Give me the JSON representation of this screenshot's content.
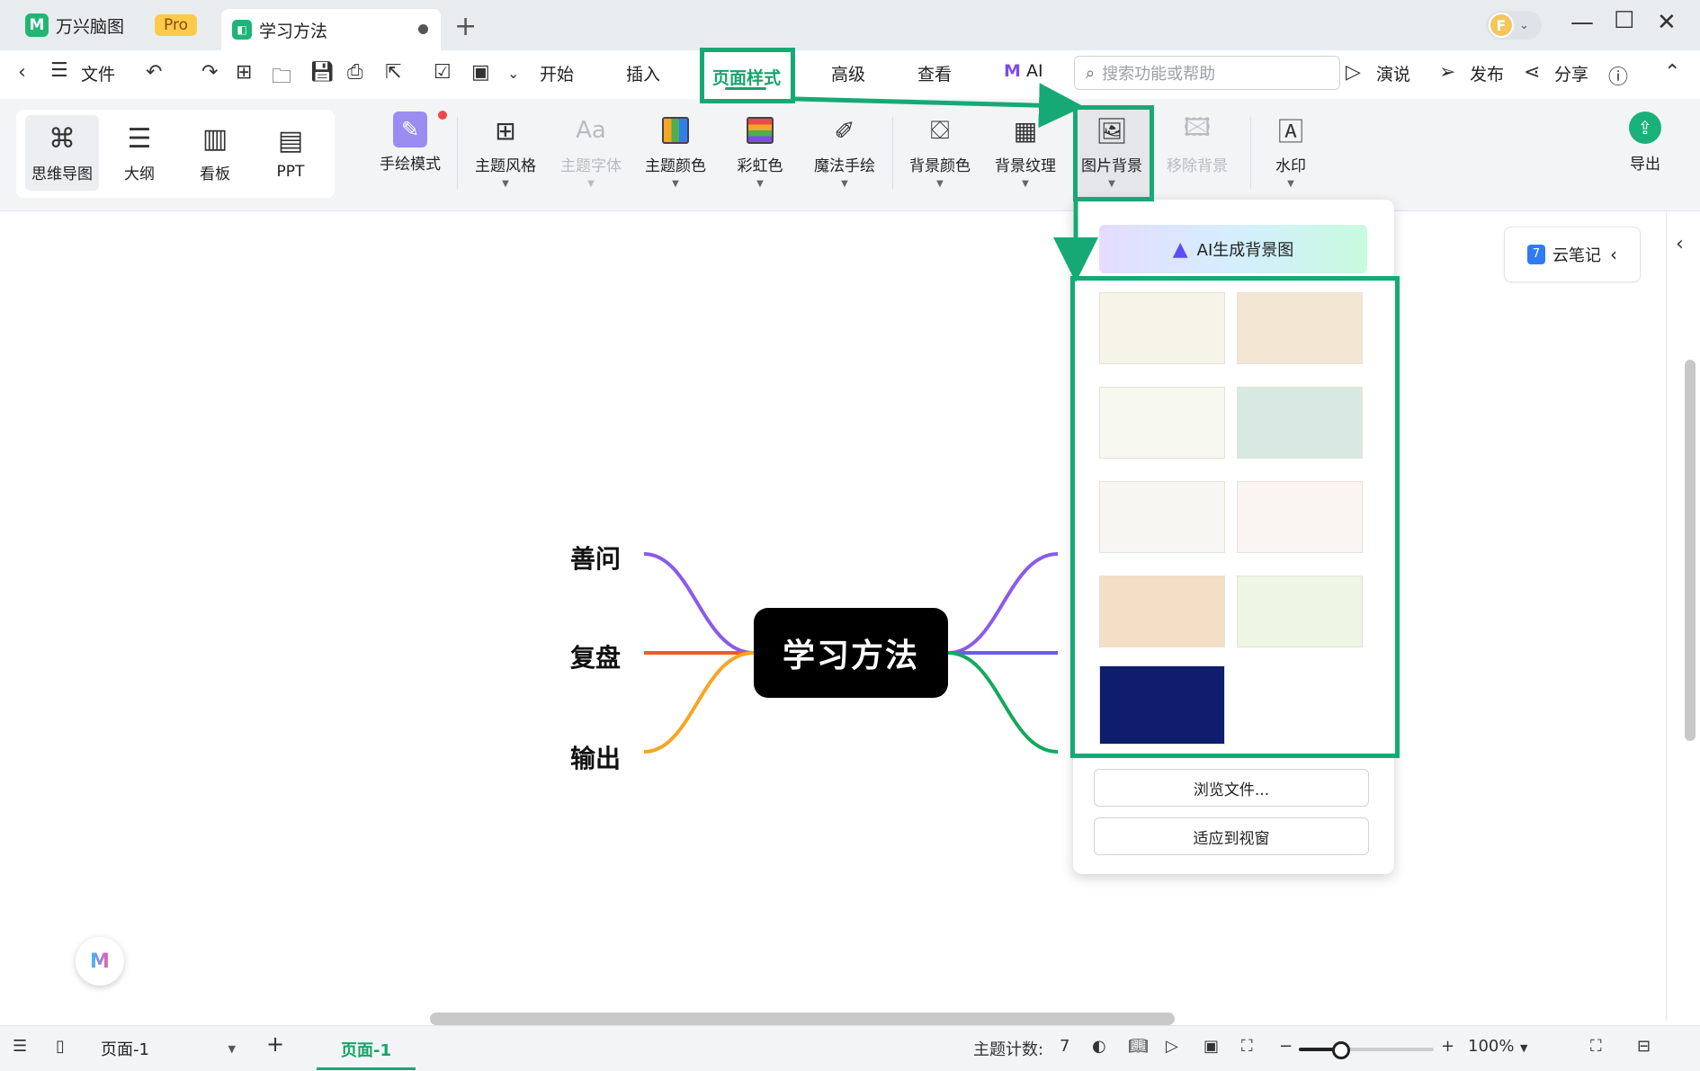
{
  "titlebar": {
    "app_name": "万兴脑图",
    "pro_badge": "Pro",
    "doc_tab": "学习方法"
  },
  "menu": {
    "file": "文件",
    "start": "开始",
    "insert": "插入",
    "page_style": "页面样式",
    "advanced": "高级",
    "view": "查看",
    "ai": "AI",
    "search_placeholder": "搜索功能或帮助",
    "present": "演说",
    "publish": "发布",
    "share": "分享"
  },
  "ribbon": {
    "views": [
      "思维导图",
      "大纲",
      "看板",
      "PPT"
    ],
    "hand_drawn": "手绘模式",
    "theme_style": "主题风格",
    "theme_font": "主题字体",
    "theme_color": "主题颜色",
    "rainbow": "彩虹色",
    "magic_draw": "魔法手绘",
    "bg_color": "背景颜色",
    "bg_texture": "背景纹理",
    "image_bg": "图片背景",
    "remove_bg": "移除背景",
    "watermark": "水印",
    "export": "导出"
  },
  "dropdown": {
    "ai_generate": "AI生成背景图",
    "browse": "浏览文件...",
    "fit": "适应到视窗",
    "thumb_colors": [
      "#f6f3e8",
      "#f3e6d2",
      "#f7f8f0",
      "#d8e9e4",
      "#f8f6f3",
      "#faf5f3",
      "#f2dfc6",
      "#eef5e3",
      "#0e1d6e"
    ]
  },
  "mindmap": {
    "central": "学习方法",
    "branches": [
      "善问",
      "复盘",
      "输出"
    ],
    "branch_colors": [
      "#8a5bea",
      "#ef5a24",
      "#f5a623",
      "#8a5bea",
      "#6a5cf2",
      "#14a85c"
    ]
  },
  "side": {
    "cloud_note": "云笔记"
  },
  "status": {
    "page_select": "页面-1",
    "page_tab": "页面-1",
    "topic_count_label": "主题计数:",
    "topic_count": "7",
    "zoom": "100%",
    "zoom_fraction": 0.3
  },
  "colors": {
    "accent": "#17a975",
    "central_bg": "#000000"
  }
}
